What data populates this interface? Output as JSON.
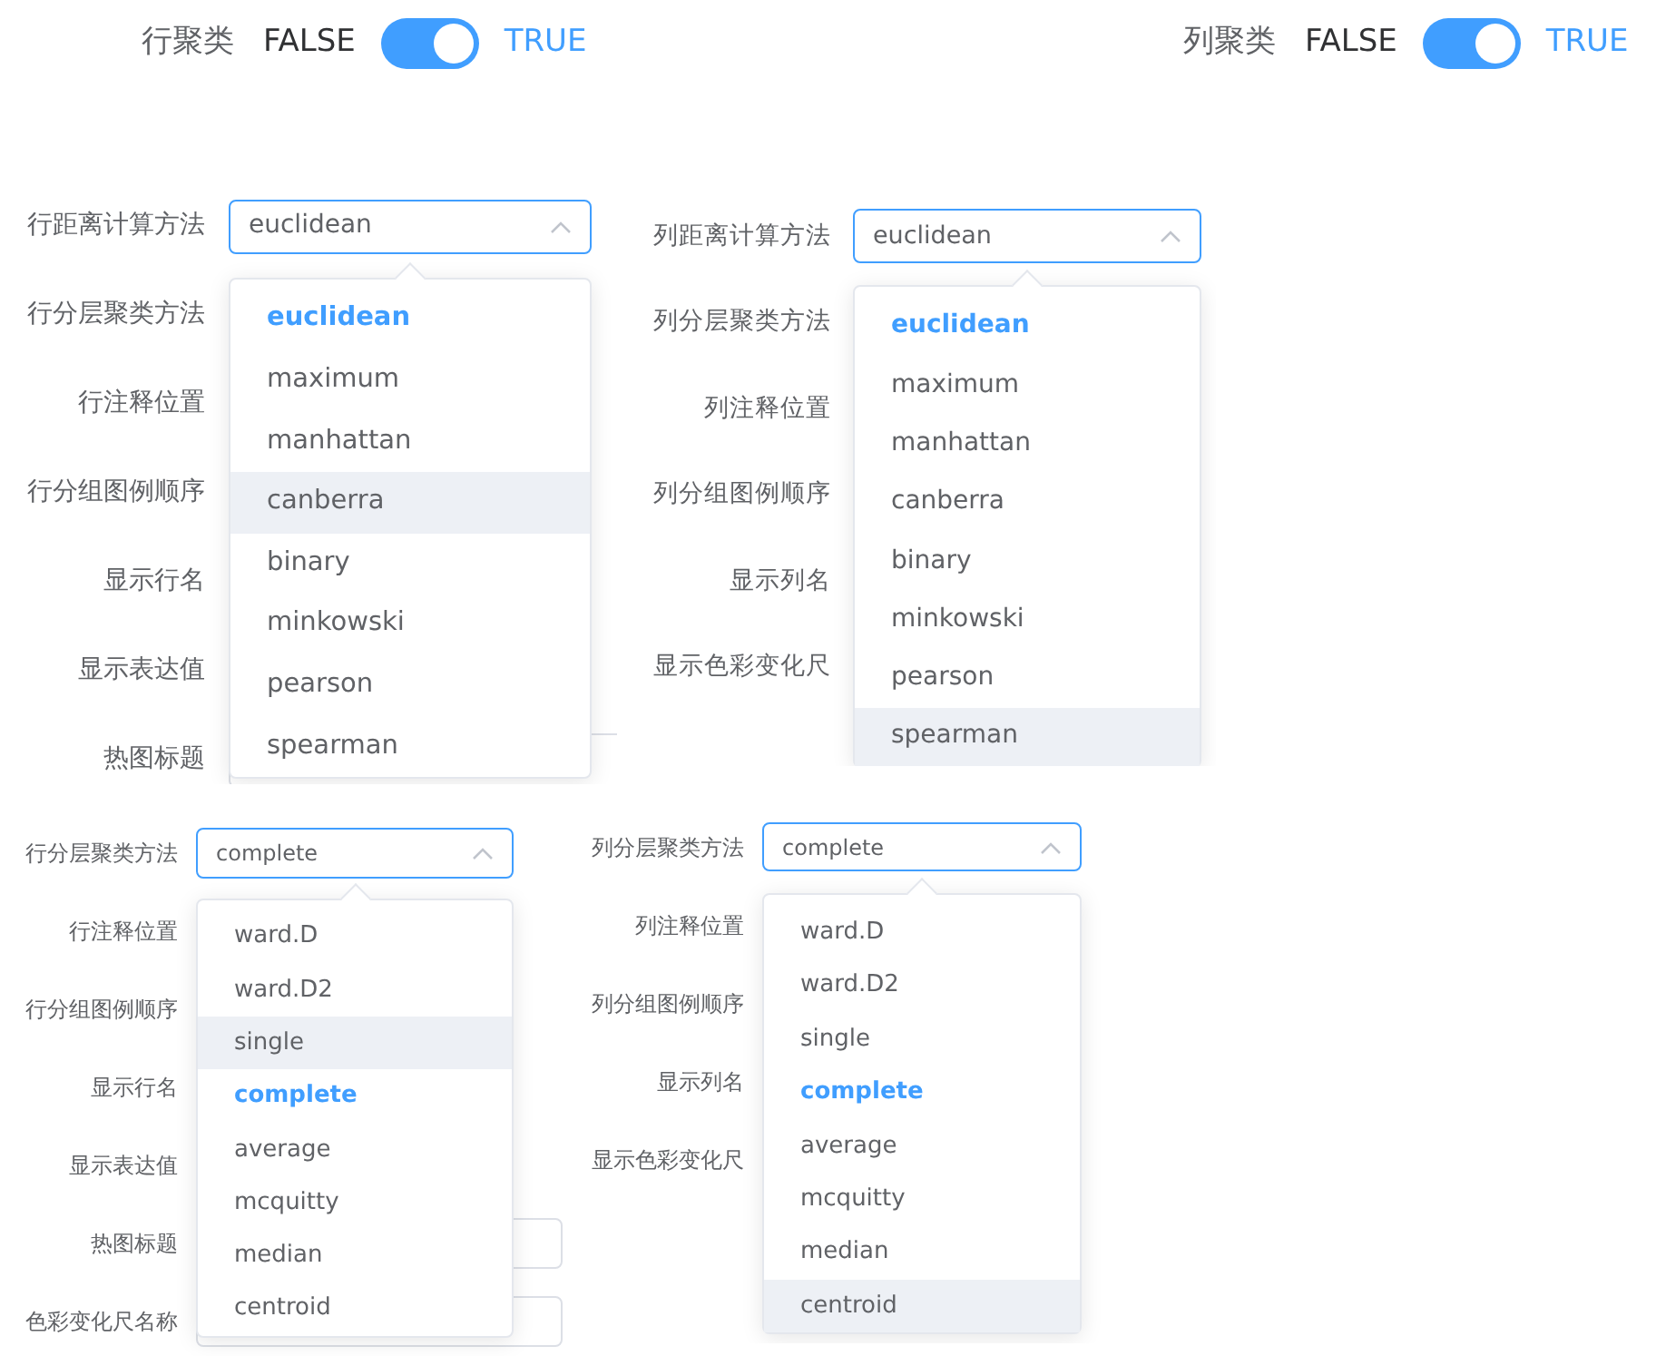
{
  "switches": [
    {
      "label": "行聚类",
      "off_text": "FALSE",
      "on_text": "TRUE",
      "on": true
    },
    {
      "label": "列聚类",
      "off_text": "FALSE",
      "on_text": "TRUE",
      "on": true
    }
  ],
  "panels": [
    {
      "form_items": [
        {
          "kind": "select",
          "label": "行距离计算方法",
          "value": "euclidean",
          "expanded": true,
          "options": [
            {
              "label": "euclidean",
              "selected": true,
              "hovered": false
            },
            {
              "label": "maximum",
              "selected": false,
              "hovered": false
            },
            {
              "label": "manhattan",
              "selected": false,
              "hovered": false
            },
            {
              "label": "canberra",
              "selected": false,
              "hovered": true
            },
            {
              "label": "binary",
              "selected": false,
              "hovered": false
            },
            {
              "label": "minkowski",
              "selected": false,
              "hovered": false
            },
            {
              "label": "pearson",
              "selected": false,
              "hovered": false
            },
            {
              "label": "spearman",
              "selected": false,
              "hovered": false
            }
          ]
        },
        {
          "kind": "label",
          "label": "行分层聚类方法"
        },
        {
          "kind": "label",
          "label": "行注释位置"
        },
        {
          "kind": "label",
          "label": "行分组图例顺序"
        },
        {
          "kind": "label",
          "label": "显示行名"
        },
        {
          "kind": "label",
          "label": "显示表达值"
        },
        {
          "kind": "input",
          "label": "热图标题"
        }
      ]
    },
    {
      "form_items": [
        {
          "kind": "select",
          "label": "列距离计算方法",
          "value": "euclidean",
          "expanded": true,
          "options": [
            {
              "label": "euclidean",
              "selected": true,
              "hovered": false
            },
            {
              "label": "maximum",
              "selected": false,
              "hovered": false
            },
            {
              "label": "manhattan",
              "selected": false,
              "hovered": false
            },
            {
              "label": "canberra",
              "selected": false,
              "hovered": false
            },
            {
              "label": "binary",
              "selected": false,
              "hovered": false
            },
            {
              "label": "minkowski",
              "selected": false,
              "hovered": false
            },
            {
              "label": "pearson",
              "selected": false,
              "hovered": false
            },
            {
              "label": "spearman",
              "selected": false,
              "hovered": true
            }
          ]
        },
        {
          "kind": "label",
          "label": "列分层聚类方法"
        },
        {
          "kind": "label",
          "label": "列注释位置"
        },
        {
          "kind": "label",
          "label": "列分组图例顺序"
        },
        {
          "kind": "label",
          "label": "显示列名"
        },
        {
          "kind": "label",
          "label": "显示色彩变化尺"
        }
      ]
    },
    {
      "form_items": [
        {
          "kind": "select",
          "label": "行分层聚类方法",
          "value": "complete",
          "expanded": true,
          "options": [
            {
              "label": "ward.D",
              "selected": false,
              "hovered": false
            },
            {
              "label": "ward.D2",
              "selected": false,
              "hovered": false
            },
            {
              "label": "single",
              "selected": false,
              "hovered": true
            },
            {
              "label": "complete",
              "selected": true,
              "hovered": false
            },
            {
              "label": "average",
              "selected": false,
              "hovered": false
            },
            {
              "label": "mcquitty",
              "selected": false,
              "hovered": false
            },
            {
              "label": "median",
              "selected": false,
              "hovered": false
            },
            {
              "label": "centroid",
              "selected": false,
              "hovered": false
            }
          ]
        },
        {
          "kind": "label",
          "label": "行注释位置"
        },
        {
          "kind": "label",
          "label": "行分组图例顺序"
        },
        {
          "kind": "label",
          "label": "显示行名"
        },
        {
          "kind": "label",
          "label": "显示表达值"
        },
        {
          "kind": "input",
          "label": "热图标题"
        },
        {
          "kind": "input",
          "label": "色彩变化尺名称"
        }
      ]
    },
    {
      "form_items": [
        {
          "kind": "select",
          "label": "列分层聚类方法",
          "value": "complete",
          "expanded": true,
          "options": [
            {
              "label": "ward.D",
              "selected": false,
              "hovered": false
            },
            {
              "label": "ward.D2",
              "selected": false,
              "hovered": false
            },
            {
              "label": "single",
              "selected": false,
              "hovered": false
            },
            {
              "label": "complete",
              "selected": true,
              "hovered": false
            },
            {
              "label": "average",
              "selected": false,
              "hovered": false
            },
            {
              "label": "mcquitty",
              "selected": false,
              "hovered": false
            },
            {
              "label": "median",
              "selected": false,
              "hovered": false
            },
            {
              "label": "centroid",
              "selected": false,
              "hovered": true
            }
          ]
        },
        {
          "kind": "label",
          "label": "列注释位置"
        },
        {
          "kind": "label",
          "label": "列分组图例顺序"
        },
        {
          "kind": "label",
          "label": "显示列名"
        },
        {
          "kind": "label",
          "label": "显示色彩变化尺"
        }
      ]
    }
  ]
}
